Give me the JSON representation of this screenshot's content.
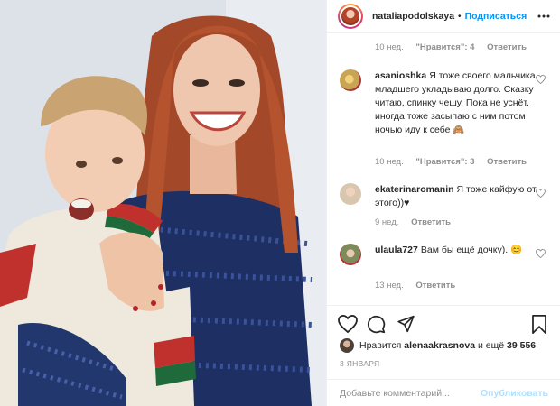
{
  "header": {
    "username": "nataliapodolskaya",
    "separator": "•",
    "follow_label": "Подписаться",
    "avatar_icon": "profile-avatar",
    "more_icon": "more-horizontal-icon"
  },
  "comments": {
    "first_meta": {
      "time": "10 нед.",
      "likes": "\"Нравится\": 4",
      "reply": "Ответить"
    },
    "items": [
      {
        "username": "asanioshka",
        "text": "Я тоже своего мальчика младшего укладываю долго. Сказку читаю, спинку чешу. Пока не уснёт. иногда тоже засыпаю с ним потом ночью иду к себе 🙈",
        "time": "10 нед.",
        "likes": "\"Нравится\": 3",
        "reply": "Ответить",
        "avatar_color": "#c9a455"
      },
      {
        "username": "ekaterinaromanin",
        "text": "Я тоже кайфую от этого))♥",
        "time": "9 нед.",
        "likes": "",
        "reply": "Ответить",
        "avatar_color": "#c7b59e"
      },
      {
        "username": "ulaula727",
        "text": "Вам бы ещё дочку). 😊",
        "time": "13 нед.",
        "likes": "",
        "reply": "Ответить",
        "avatar_color": "#7d8a5a"
      }
    ]
  },
  "actions": {
    "like_icon": "heart-icon",
    "comment_icon": "comment-icon",
    "share_icon": "share-icon",
    "save_icon": "bookmark-icon"
  },
  "likes": {
    "prefix": "Нравится",
    "user": "alenaakrasnova",
    "middle": "и ещё",
    "count": "39 556"
  },
  "date": "3 ЯНВАРЯ",
  "add_comment": {
    "placeholder": "Добавьте комментарий...",
    "publish_label": "Опубликовать"
  },
  "colors": {
    "accent": "#0095f6",
    "muted": "#8e8e8e",
    "publish_disabled": "#b2dffc"
  }
}
